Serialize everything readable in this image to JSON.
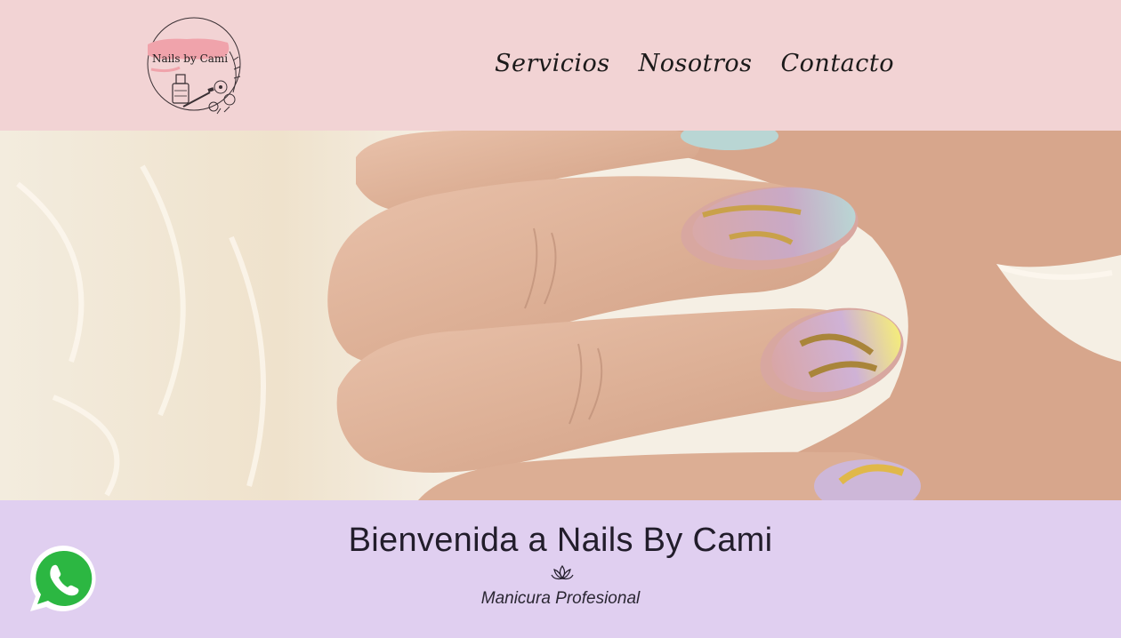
{
  "header": {
    "logo_text": "Nails by Cami",
    "nav": [
      {
        "label": "Servicios"
      },
      {
        "label": "Nosotros"
      },
      {
        "label": "Contacto"
      }
    ]
  },
  "welcome": {
    "title": "Bienvenida a Nails By Cami",
    "subtitle": "Manicura Profesional"
  },
  "icons": {
    "lotus": "lotus-icon",
    "whatsapp": "whatsapp-icon"
  },
  "colors": {
    "header_bg": "#f2d3d4",
    "welcome_bg": "#e0cff0",
    "logo_brush": "#f0a3ab",
    "whatsapp_green": "#2cb742"
  }
}
